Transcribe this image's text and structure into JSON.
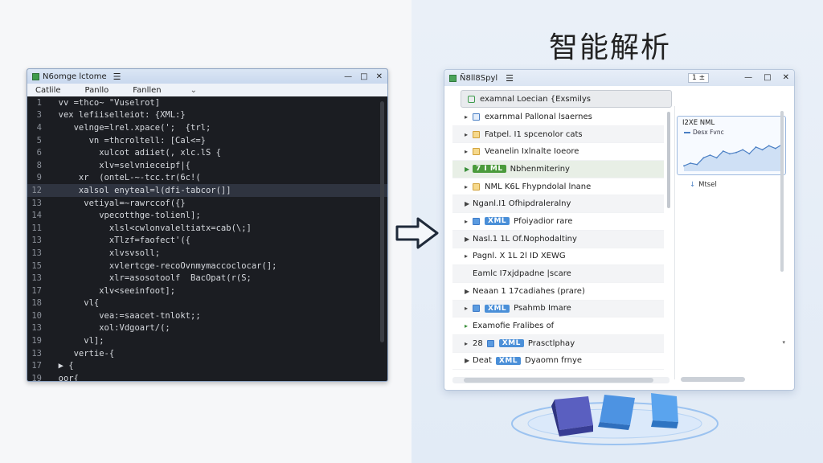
{
  "headline": "智能解析",
  "editor": {
    "title": "N6omge lctome",
    "menu_glyph": "☰",
    "controls": [
      "—",
      "□",
      "✕"
    ],
    "menu": [
      "Catlile",
      "Panllo",
      "Fanllen"
    ],
    "menu_chevron": "⌄",
    "lines": [
      {
        "n": "1",
        "code": "  vv =thco~ \"Vuselrot]"
      },
      {
        "n": "3",
        "code": "  vex lefiiselleiot: {XML:}"
      },
      {
        "n": "4",
        "code": "     velnge=lrel.xpace(';  {trl;"
      },
      {
        "n": "5",
        "code": "        vn =thcroltell: [Cal<=}"
      },
      {
        "n": "6",
        "code": "          xulcot adiiet(, xlc.lS {"
      },
      {
        "n": "8",
        "code": "          xlv=selvnieceipf|{"
      },
      {
        "n": "9",
        "code": "      xr  (onteL-~-tcc.tr(6c!("
      },
      {
        "n": "12",
        "code": "      xalsol enyteal=l(dfi-tabcor(]]"
      },
      {
        "n": "13",
        "code": "       vetiyal=~rawrccof({}"
      },
      {
        "n": "14",
        "code": "          vpecotthge-tolienl];"
      },
      {
        "n": "11",
        "code": "            xlsl<cwlonvaleltiatx=cab(\\;]"
      },
      {
        "n": "13",
        "code": "            xTlzf=faofect'({"
      },
      {
        "n": "13",
        "code": "            xlvsvsoll;"
      },
      {
        "n": "15",
        "code": "            xvlertcge-recoOvnmymaccoclocar(];"
      },
      {
        "n": "13",
        "code": "            xlr=asosotoolf  BacOpat(r(S;"
      },
      {
        "n": "17",
        "code": "          xlv<seeinfoot];"
      },
      {
        "n": "18",
        "code": "       vl{"
      },
      {
        "n": "10",
        "code": "          vea:=saacet-tnlokt;;"
      },
      {
        "n": "13",
        "code": "          xol:Vdgoart/(;"
      },
      {
        "n": "19",
        "code": "       vl];"
      },
      {
        "n": "13",
        "code": "     vertie-{"
      },
      {
        "n": "17",
        "code": "  ▶ {"
      },
      {
        "n": "19",
        "code": "  oor{"
      }
    ]
  },
  "viewer": {
    "title": "Ñ8ll8Spyl",
    "menu_glyph": "☰",
    "zoom_label": "1 ±",
    "controls": [
      "—",
      "□",
      "✕"
    ],
    "root_label": "examnal Loecian {Exsmilys",
    "rows": [
      {
        "tri": "▸",
        "icon": "doc",
        "badge": "",
        "label": "exarnmal Pallonal lsaernes"
      },
      {
        "tri": "▸",
        "icon": "folder",
        "badge": "",
        "label": "Fatpel. I1 spcenolor cats"
      },
      {
        "tri": "▸",
        "icon": "folder",
        "badge": "",
        "label": "Veanelin Ixlnalte Ioeore"
      },
      {
        "tri": "▶",
        "icon": "",
        "badge": "7 I ML",
        "badge_color": "green",
        "label": "Nbhenmiteriny"
      },
      {
        "tri": "▸",
        "icon": "folder",
        "badge": "",
        "label": "NML K6L Fhypndolal lnane"
      },
      {
        "tri": "▶",
        "icon": "",
        "badge": "",
        "label": "Nganl.I1 Ofhipdraleralny"
      },
      {
        "tri": "▸",
        "icon": "sq",
        "badge": "XML",
        "badge_color": "blue",
        "label": "Pfoiyadior rare"
      },
      {
        "tri": "▶",
        "icon": "",
        "badge": "",
        "label": "Nasl.1 1L Of.Nophodaltiny"
      },
      {
        "tri": "▸",
        "icon": "",
        "badge": "",
        "label": "Pagnl. X 1L 2l ID XEWG"
      },
      {
        "tri": "",
        "icon": "",
        "badge": "",
        "label": "Eamlc I7xjdpadne |scare"
      },
      {
        "tri": "▶",
        "icon": "",
        "badge": "",
        "label": "Neaan 1 17cadiahes (prare)"
      },
      {
        "tri": "▸",
        "icon": "sq",
        "badge": "XML",
        "badge_color": "blue",
        "label": "Psahmb Imare"
      },
      {
        "tri": "▸",
        "icon": "",
        "badge": "",
        "tri_color": "green",
        "label": "Examofie Fralibes of"
      },
      {
        "tri": "▸",
        "icon": "sq",
        "badge": "XML",
        "badge_prefix": "28",
        "badge_color": "blue",
        "label": "Prasctlphay"
      },
      {
        "tri": "▶",
        "icon": "",
        "badge": "XML",
        "badge_prefix": "Deat",
        "badge_color": "blue",
        "label": "Dyaomn frnye"
      }
    ],
    "chart": {
      "title": "I2XE NML",
      "series_label": "Desx Fvnc",
      "footer_label": "Mtsel",
      "footer_glyph": "↓",
      "line_color": "#4a7fc4",
      "fill_color": "#cfe0f5"
    },
    "right_arrow": "▾"
  },
  "chart_data": {
    "type": "area",
    "title": "I2XE NML",
    "series": [
      {
        "name": "Desx Fvnc",
        "values": [
          2,
          3,
          2.5,
          5,
          6,
          5,
          7.5,
          6.5,
          7,
          8,
          6.5,
          9,
          8,
          9.5,
          8.5,
          10
        ]
      }
    ],
    "ylim": [
      0,
      12
    ]
  }
}
